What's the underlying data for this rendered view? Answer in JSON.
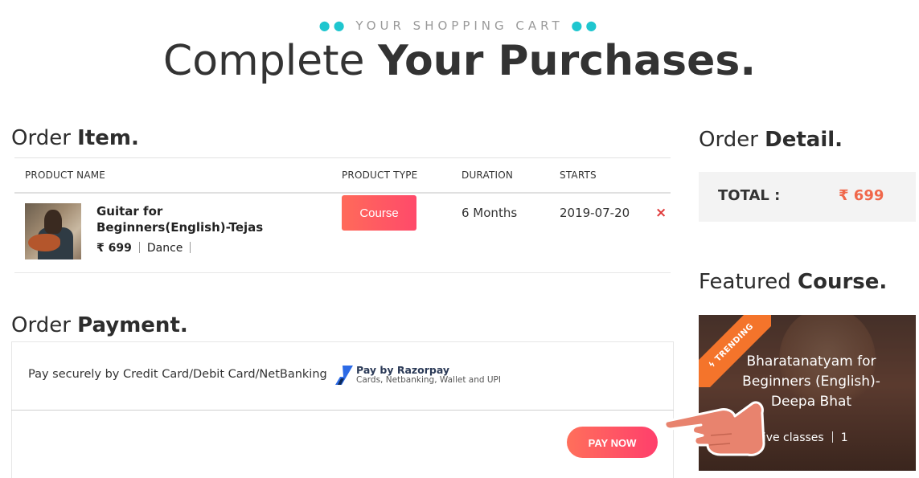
{
  "header": {
    "eyebrow": "YOUR SHOPPING CART",
    "title_regular": "Complete",
    "title_bold": "Your Purchases."
  },
  "order_item": {
    "title_regular": "Order",
    "title_bold": "Item.",
    "columns": [
      "PRODUCT NAME",
      "PRODUCT TYPE",
      "DURATION",
      "STARTS"
    ],
    "row": {
      "name": "Guitar for Beginners(English)-Tejas",
      "price": "₹ 699",
      "category": "Dance",
      "type": "Course",
      "duration": "6 Months",
      "starts": "2019-07-20",
      "remove_icon": "×"
    }
  },
  "order_payment": {
    "title_regular": "Order",
    "title_bold": "Payment.",
    "method_text": "Pay securely by Credit Card/Debit Card/NetBanking",
    "razorpay_title": "Pay by Razorpay",
    "razorpay_sub": "Cards, Netbanking, Wallet and UPI",
    "pay_button": "PAY NOW"
  },
  "order_detail": {
    "title_regular": "Order",
    "title_bold": "Detail.",
    "total_label": "TOTAL :",
    "total_value": "₹ 699"
  },
  "featured": {
    "title_regular": "Featured",
    "title_bold": "Course.",
    "ribbon": "TRENDING",
    "course_title": "Bharatanatyam for Beginners (English)- Deepa Bhat",
    "meta_label": "Live classes",
    "meta_value": "1"
  },
  "colors": {
    "accent_dots": "#1fc6cf",
    "button_gradient_start": "#ff6a5a",
    "button_gradient_end": "#ff4a6a",
    "total_value": "#f0674a",
    "ribbon": "#f4742b",
    "remove": "#e03a3a"
  }
}
